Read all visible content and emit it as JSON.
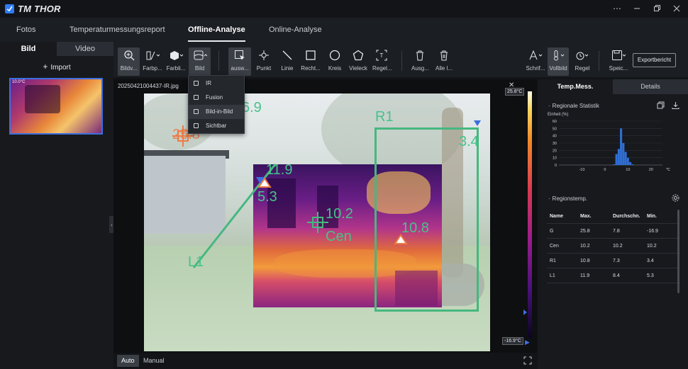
{
  "app": {
    "title": "TM THOR"
  },
  "nav": {
    "tabs": [
      {
        "label": "Fotos"
      },
      {
        "label": "Temperaturmessungsreport"
      },
      {
        "label": "Offline-Analyse"
      },
      {
        "label": "Online-Analyse"
      }
    ]
  },
  "left": {
    "tabs": [
      {
        "label": "Bild"
      },
      {
        "label": "Video"
      }
    ],
    "import_label": "Import",
    "thumb_hud": "10.0°C"
  },
  "toolbar": {
    "items": [
      {
        "label": "Bildv..."
      },
      {
        "label": "Farbp..."
      },
      {
        "label": "Farbli..."
      },
      {
        "label": "Bild"
      },
      {
        "label": "ausw..."
      },
      {
        "label": "Punkt"
      },
      {
        "label": "Linie"
      },
      {
        "label": "Recht..."
      },
      {
        "label": "Kreis"
      },
      {
        "label": "Vieleck"
      },
      {
        "label": "Regel..."
      },
      {
        "label": "Ausg..."
      },
      {
        "label": "Alle l..."
      },
      {
        "label": "Schrif..."
      },
      {
        "label": "Vollbild"
      },
      {
        "label": "Regel"
      },
      {
        "label": "Speic..."
      }
    ],
    "export_label": "Exportbericht"
  },
  "dropdown": {
    "items": [
      {
        "label": "IR"
      },
      {
        "label": "Fusion"
      },
      {
        "label": "Bild-in-Bild"
      },
      {
        "label": "Sichtbar"
      }
    ]
  },
  "viewer": {
    "filename": "20250421004437-IR.jpg",
    "scale_max": "25.8°C",
    "scale_min": "-16.9°C",
    "marks": {
      "g_max": "25.8",
      "g_partial": "6.9",
      "r1_label": "R1",
      "r1_min": "3.4",
      "l1_max": "11.9",
      "l1_min": "5.3",
      "l1_label": "L1",
      "cen_val": "10.2",
      "cen_label": "Cen",
      "r1_max": "10.8"
    }
  },
  "bottom": {
    "modes": [
      {
        "label": "Auto"
      },
      {
        "label": "Manual"
      }
    ]
  },
  "right": {
    "tabs": [
      {
        "label": "Temp.Mess."
      },
      {
        "label": "Details"
      }
    ],
    "stats_title": "Regionale Statistik",
    "unit_label": "Einheit (%)",
    "regions_title": "Regionstemp.",
    "table": {
      "headers": [
        "Name",
        "Max.",
        "Durchschn.",
        "Min."
      ],
      "rows": [
        [
          "G",
          "25.8",
          "7.8",
          "-16.9"
        ],
        [
          "Cen",
          "10.2",
          "10.2",
          "10.2"
        ],
        [
          "R1",
          "10.8",
          "7.3",
          "3.4"
        ],
        [
          "L1",
          "11.9",
          "8.4",
          "5.3"
        ]
      ]
    }
  },
  "chart_data": {
    "type": "bar",
    "title": "",
    "ylabel": "Einheit (%)",
    "xlabel": "",
    "x_unit": "℃",
    "ylim": [
      0,
      60
    ],
    "xlim": [
      -20,
      25
    ],
    "y_ticks": [
      0,
      10,
      20,
      30,
      40,
      50,
      60
    ],
    "x_ticks": [
      -10,
      0,
      10,
      20
    ],
    "x": [
      4,
      5,
      6,
      7,
      8,
      9,
      10,
      11,
      12
    ],
    "values": [
      1,
      15,
      22,
      50,
      30,
      18,
      10,
      4,
      1
    ],
    "color": "#2f6fd6"
  }
}
